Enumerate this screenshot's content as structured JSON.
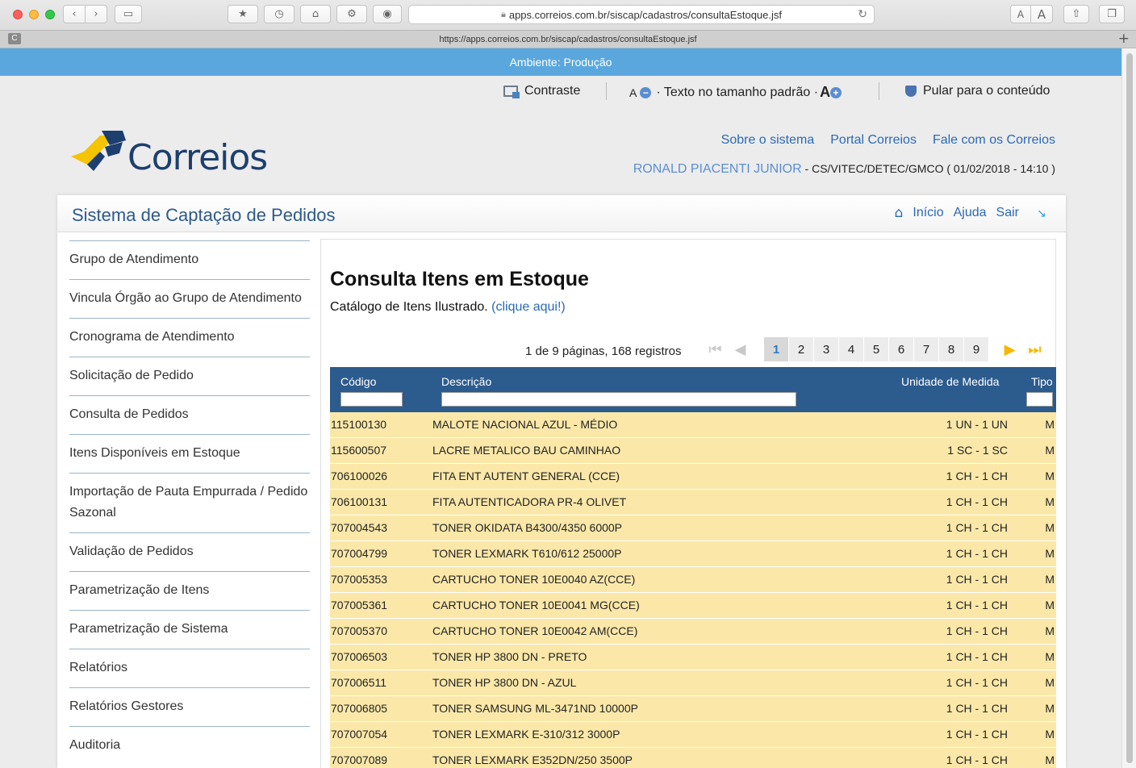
{
  "browser": {
    "url_display": "apps.correios.com.br/siscap/cadastros/consultaEstoque.jsf",
    "tab_url": "https://apps.correios.com.br/siscap/cadastros/consultaEstoque.jsf",
    "tab_favicon_letter": "C",
    "reader_font_small": "A",
    "reader_font_large": "A"
  },
  "environment": {
    "label": "Ambiente: Produção"
  },
  "accessibility": {
    "contrast": "Contraste",
    "font_decrease_letter": "A",
    "font_default": "· Texto no tamanho padrão ·",
    "font_increase_letter": "A",
    "skip_to_content": "Pular para o conteúdo"
  },
  "brand": {
    "logo_text": "Correios"
  },
  "top_links": [
    "Sobre o sistema",
    "Portal Correios",
    "Fale com os Correios"
  ],
  "user": {
    "name": "RONALD PIACENTI JUNIOR",
    "details": " - CS/VITEC/DETEC/GMCO ( 01/02/2018 - 14:10 )"
  },
  "system": {
    "title": "Sistema de Captação de Pedidos",
    "nav": {
      "home": "Início",
      "help": "Ajuda",
      "exit": "Sair"
    }
  },
  "sidebar": {
    "items": [
      "Grupo de Atendimento",
      "Vincula Órgão ao Grupo de Atendimento",
      "Cronograma de Atendimento",
      "Solicitação de Pedido",
      "Consulta de Pedidos",
      "Itens Disponíveis em Estoque",
      "Importação de Pauta Empurrada / Pedido Sazonal",
      "Validação de Pedidos",
      "Parametrização de Itens",
      "Parametrização de Sistema",
      "Relatórios",
      "Relatórios Gestores",
      "Auditoria"
    ]
  },
  "main": {
    "title": "Consulta Itens em Estoque",
    "catalog_text": "Catálogo de Itens Ilustrado.",
    "catalog_link": "(clique aqui!)",
    "page_info": "1 de 9 páginas, 168 registros",
    "pages": [
      "1",
      "2",
      "3",
      "4",
      "5",
      "6",
      "7",
      "8",
      "9"
    ],
    "current_page": "1",
    "columns": {
      "codigo": "Código",
      "descricao": "Descrição",
      "unidade": "Unidade de Medida",
      "tipo": "Tipo"
    },
    "rows": [
      [
        "115100130",
        "MALOTE NACIONAL AZUL - MÉDIO",
        "1 UN - 1 UN",
        "M"
      ],
      [
        "115600507",
        "LACRE METALICO BAU CAMINHAO",
        "1 SC - 1 SC",
        "M"
      ],
      [
        "706100026",
        "FITA ENT AUTENT GENERAL (CCE)",
        "1 CH - 1 CH",
        "M"
      ],
      [
        "706100131",
        "FITA AUTENTICADORA PR-4 OLIVET",
        "1 CH - 1 CH",
        "M"
      ],
      [
        "707004543",
        "TONER OKIDATA B4300/4350 6000P",
        "1 CH - 1 CH",
        "M"
      ],
      [
        "707004799",
        "TONER LEXMARK T610/612 25000P",
        "1 CH - 1 CH",
        "M"
      ],
      [
        "707005353",
        "CARTUCHO TONER 10E0040 AZ(CCE)",
        "1 CH - 1 CH",
        "M"
      ],
      [
        "707005361",
        "CARTUCHO TONER 10E0041 MG(CCE)",
        "1 CH - 1 CH",
        "M"
      ],
      [
        "707005370",
        "CARTUCHO TONER 10E0042 AM(CCE)",
        "1 CH - 1 CH",
        "M"
      ],
      [
        "707006503",
        "TONER HP 3800 DN - PRETO",
        "1 CH - 1 CH",
        "M"
      ],
      [
        "707006511",
        "TONER HP 3800 DN - AZUL",
        "1 CH - 1 CH",
        "M"
      ],
      [
        "707006805",
        "TONER SAMSUNG ML-3471ND 10000P",
        "1 CH - 1 CH",
        "M"
      ],
      [
        "707007054",
        "TONER LEXMARK E-310/312 3000P",
        "1 CH - 1 CH",
        "M"
      ],
      [
        "707007089",
        "TONER LEXMARK E352DN/250 3500P",
        "1 CH - 1 CH",
        "M"
      ]
    ]
  },
  "colors": {
    "env_bar": "#5aa7dd",
    "table_header": "#2c5b8d",
    "row_bg": "#fbe8a9",
    "link": "#2a6ab4"
  }
}
